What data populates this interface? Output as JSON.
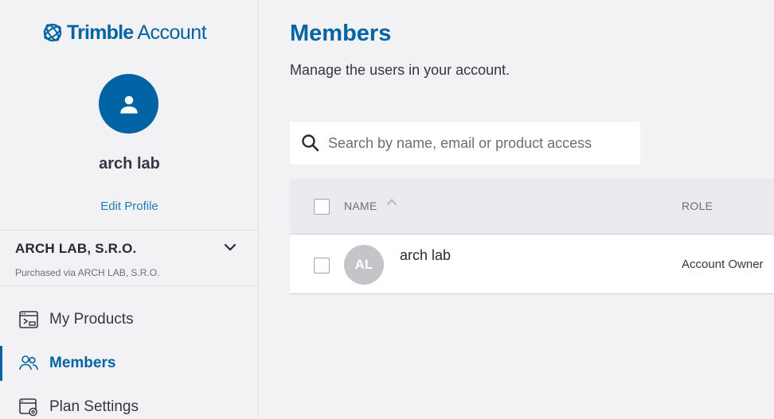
{
  "brand": {
    "name_strong": "Trimble",
    "name_light": "Account"
  },
  "colors": {
    "brand": "#0063a3",
    "link": "#217cbb",
    "active_nav": "#0063a3"
  },
  "profile": {
    "name": "arch lab",
    "edit_label": "Edit Profile"
  },
  "organization": {
    "name": "ARCH LAB, S.R.O.",
    "purchased_via": "Purchased via ARCH LAB, S.R.O."
  },
  "nav": {
    "items": [
      {
        "label": "My Products",
        "icon": "products-icon"
      },
      {
        "label": "Members",
        "icon": "members-icon",
        "active": true
      },
      {
        "label": "Plan Settings",
        "icon": "plan-settings-icon"
      }
    ]
  },
  "main": {
    "title": "Members",
    "subtitle": "Manage the users in your account.",
    "search": {
      "placeholder": "Search by name, email or product access",
      "value": ""
    },
    "table": {
      "headers": {
        "name": "NAME",
        "role": "ROLE"
      },
      "rows": [
        {
          "initials": "AL",
          "name": "arch lab",
          "role": "Account Owner"
        }
      ]
    }
  }
}
